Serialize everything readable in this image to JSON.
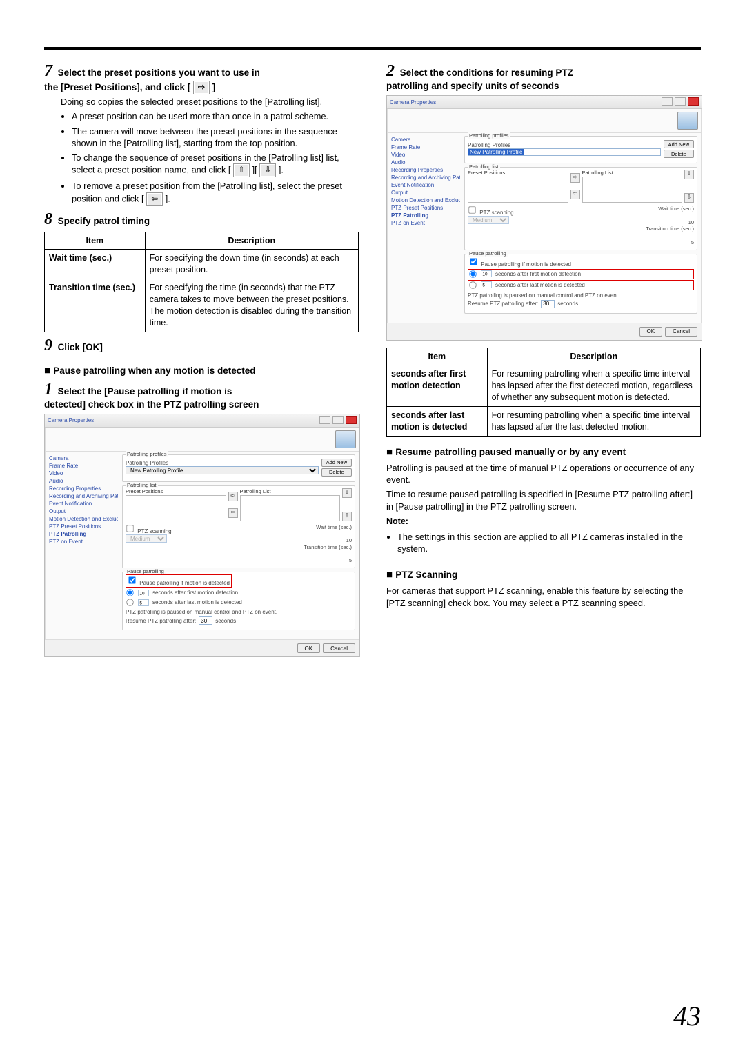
{
  "page_number": "43",
  "left": {
    "step7": {
      "title_l1": "Select the preset positions you want to use in",
      "title_l2": "the [Preset Positions], and click [",
      "title_l3": "]",
      "p1": "Doing so copies the selected preset positions to the [Patrolling list].",
      "b1": "A preset position can be used more than once in a patrol scheme.",
      "b2": "The camera will move between the preset positions in the sequence shown in the [Patrolling list], starting from the top position.",
      "b3a": "To change the sequence of preset positions in the [Patrolling list] list, select a preset position name, and click [",
      "b3b": "][",
      "b3c": "].",
      "b4a": "To remove a preset position from the [Patrolling list], select the preset position and click [",
      "b4b": "]."
    },
    "step8": {
      "title": "Specify patrol timing",
      "table": {
        "h1": "Item",
        "h2": "Description",
        "r1c1": "Wait time (sec.)",
        "r1c2": "For specifying the down time (in seconds) at each preset position.",
        "r2c1": "Transition time (sec.)",
        "r2c2a": "For specifying the time (in seconds) that the PTZ camera takes to move between the preset positions.",
        "r2c2b": "The motion detection is disabled during the transition time."
      }
    },
    "step9": {
      "title": "Click [OK]"
    },
    "sec_pause": {
      "head": "Pause patrolling when any motion is detected",
      "step1_l1": "Select the [Pause patrolling if motion is",
      "step1_l2": "detected] check box in the PTZ patrolling screen"
    }
  },
  "right": {
    "step2": {
      "title_l1": "Select the conditions for resuming PTZ",
      "title_l2": "patrolling and specify units of seconds"
    },
    "table": {
      "h1": "Item",
      "h2": "Description",
      "r1c1": "seconds after first motion detection",
      "r1c2": "For resuming patrolling when a specific time interval has lapsed after the first detected motion, regardless of whether any subsequent motion is detected.",
      "r2c1": "seconds after last motion is detected",
      "r2c2": "For resuming patrolling when a specific time interval has lapsed after the last detected motion."
    },
    "sec_resume": {
      "head": "Resume patrolling paused manually or by any event",
      "p1": "Patrolling is paused at the time of manual PTZ operations or occurrence of any event.",
      "p2": "Time to resume paused patrolling is specified in [Resume PTZ patrolling after:] in [Pause patrolling] in the PTZ patrolling screen.",
      "note_label": "Note:",
      "note_b1": "The settings in this section are applied to all PTZ cameras installed in the system."
    },
    "sec_scan": {
      "head": "PTZ Scanning",
      "p1": "For cameras that support PTZ scanning, enable this feature by selecting the [PTZ scanning] check box. You may select a PTZ scanning speed."
    }
  },
  "shot": {
    "title": "Camera Properties",
    "side": {
      "i0": "Camera",
      "i1": "Frame Rate",
      "i2": "Video",
      "i3": "Audio",
      "i4": "Recording Properties",
      "i5": "Recording and Archiving Paths",
      "i6": "Event Notification",
      "i7": "Output",
      "i8": "Motion Detection and Exclude Regions",
      "i9": "PTZ Preset Positions",
      "i10": "PTZ Patrolling",
      "i11": "PTZ on Event"
    },
    "profiles_lbl": "Patrolling profiles",
    "profiles_sub": "Patrolling Profiles",
    "profile_value": "New Patrolling Profile",
    "addnew": "Add New",
    "delete": "Delete",
    "patlist_lbl": "Patrolling list",
    "preset_head": "Preset Positions",
    "patlist_head": "Patrolling List",
    "ptzscan_chk": "PTZ scanning",
    "ptzscan_val": "Medium",
    "wait_lbl": "Wait time (sec.)",
    "wait_val": "10",
    "trans_lbl": "Transition time (sec.)",
    "trans_val": "5",
    "pause_lbl": "Pause patrolling",
    "pause_chk": "Pause patrolling if motion is detected",
    "r1_val": "10",
    "r1_lbl": "seconds after first motion detection",
    "r2_val": "5",
    "r2_lbl": "seconds after last motion is detected",
    "footer": "PTZ patrolling is paused on manual control and PTZ on event.",
    "resume_l": "Resume PTZ patrolling after:",
    "resume_v": "30",
    "resume_u": "seconds",
    "ok": "OK",
    "cancel": "Cancel"
  }
}
